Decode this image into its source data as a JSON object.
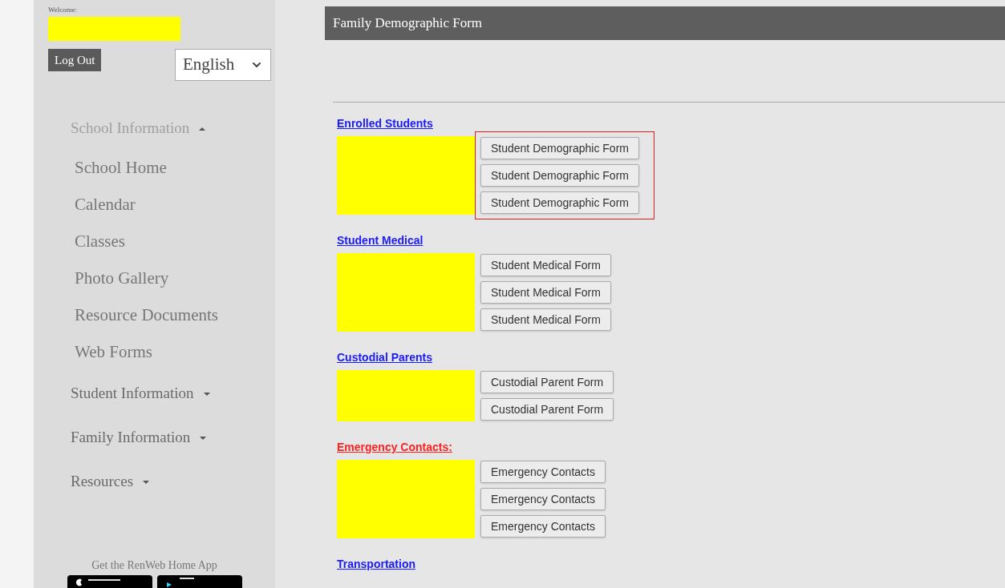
{
  "sidebar": {
    "welcome_label": "Welcome:",
    "logout_button": "Log Out",
    "language_select": {
      "value": "English"
    },
    "nav": [
      {
        "label": "School Information",
        "expanded": true,
        "children": [
          {
            "label": "School Home"
          },
          {
            "label": "Calendar"
          },
          {
            "label": "Classes"
          },
          {
            "label": "Photo Gallery"
          },
          {
            "label": "Resource Documents"
          },
          {
            "label": "Web Forms"
          }
        ]
      },
      {
        "label": "Student Information",
        "expanded": false
      },
      {
        "label": "Family Information",
        "expanded": false
      },
      {
        "label": "Resources",
        "expanded": false
      }
    ],
    "app_promo": "Get the RenWeb Home App"
  },
  "page_title": "Family Demographic Form",
  "sections": [
    {
      "heading": "Enrolled Students",
      "color": "#1a1aff",
      "highlighted": true,
      "buttons": [
        "Student Demographic Form",
        "Student Demographic Form",
        "Student Demographic Form"
      ]
    },
    {
      "heading": "Student Medical",
      "color": "#1a1aff",
      "highlighted": false,
      "buttons": [
        "Student Medical Form",
        "Student Medical Form",
        "Student Medical Form"
      ]
    },
    {
      "heading": "Custodial Parents",
      "color": "#1a1aff",
      "highlighted": false,
      "buttons": [
        "Custodial Parent Form",
        "Custodial Parent Form"
      ]
    },
    {
      "heading": "Emergency Contacts:",
      "color": "#ff2020",
      "highlighted": false,
      "buttons": [
        "Emergency Contacts",
        "Emergency Contacts",
        "Emergency Contacts"
      ]
    },
    {
      "heading": "Transportation",
      "color": "#1a1aff"
    }
  ]
}
